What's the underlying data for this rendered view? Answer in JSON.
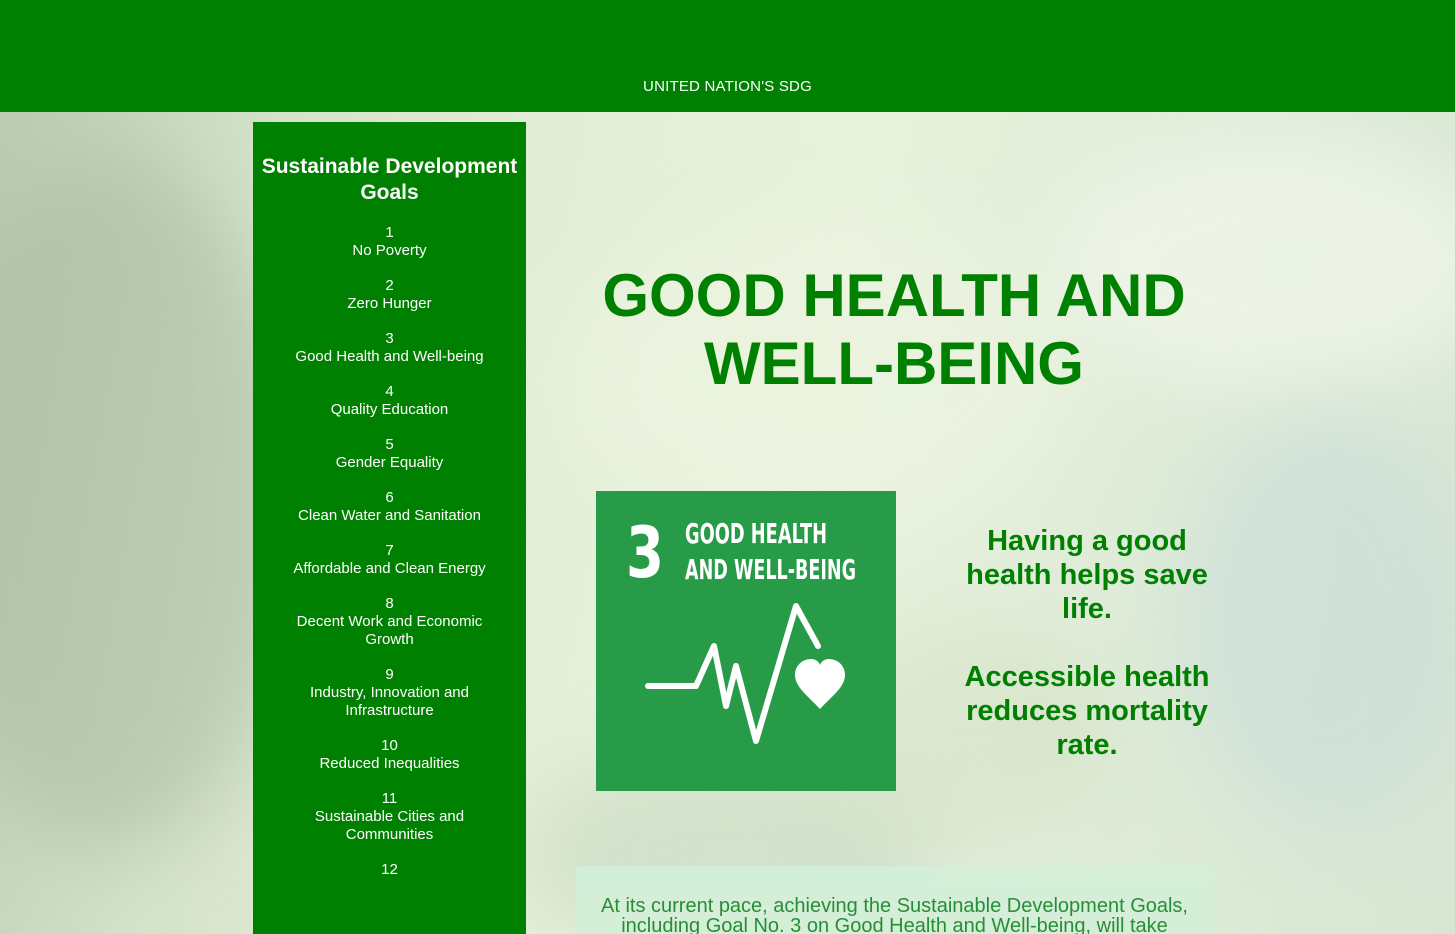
{
  "header": {
    "title": "UNITED NATION'S SDG"
  },
  "sidebar": {
    "heading": "Sustainable Development Goals",
    "goals": [
      {
        "number": "1",
        "label": "No Poverty"
      },
      {
        "number": "2",
        "label": "Zero Hunger"
      },
      {
        "number": "3",
        "label": "Good Health and Well-being"
      },
      {
        "number": "4",
        "label": "Quality Education"
      },
      {
        "number": "5",
        "label": "Gender Equality"
      },
      {
        "number": "6",
        "label": "Clean Water and Sanitation"
      },
      {
        "number": "7",
        "label": "Affordable and Clean Energy"
      },
      {
        "number": "8",
        "label": "Decent Work and Economic Growth"
      },
      {
        "number": "9",
        "label": "Industry, Innovation and Infrastructure"
      },
      {
        "number": "10",
        "label": "Reduced Inequalities"
      },
      {
        "number": "11",
        "label": "Sustainable Cities and Communities"
      },
      {
        "number": "12",
        "label": ""
      }
    ]
  },
  "main": {
    "title": "GOOD HEALTH AND WELL-BEING",
    "sdg_tile": {
      "number": "3",
      "line1": "GOOD HEALTH",
      "line2": "AND WELL-BEING",
      "icon": "heartbeat-heart-icon",
      "color": "#279b48"
    },
    "tagline_1": "Having a good health helps save life.",
    "tagline_2": "Accessible health reduces mortality rate.",
    "info_text": "At its current pace, achieving the Sustainable Development Goals, including Goal No. 3 on Good Health and Well-being, will take"
  },
  "colors": {
    "primary_green": "#008000",
    "tile_green": "#279b48",
    "text_white": "#ffffff"
  }
}
